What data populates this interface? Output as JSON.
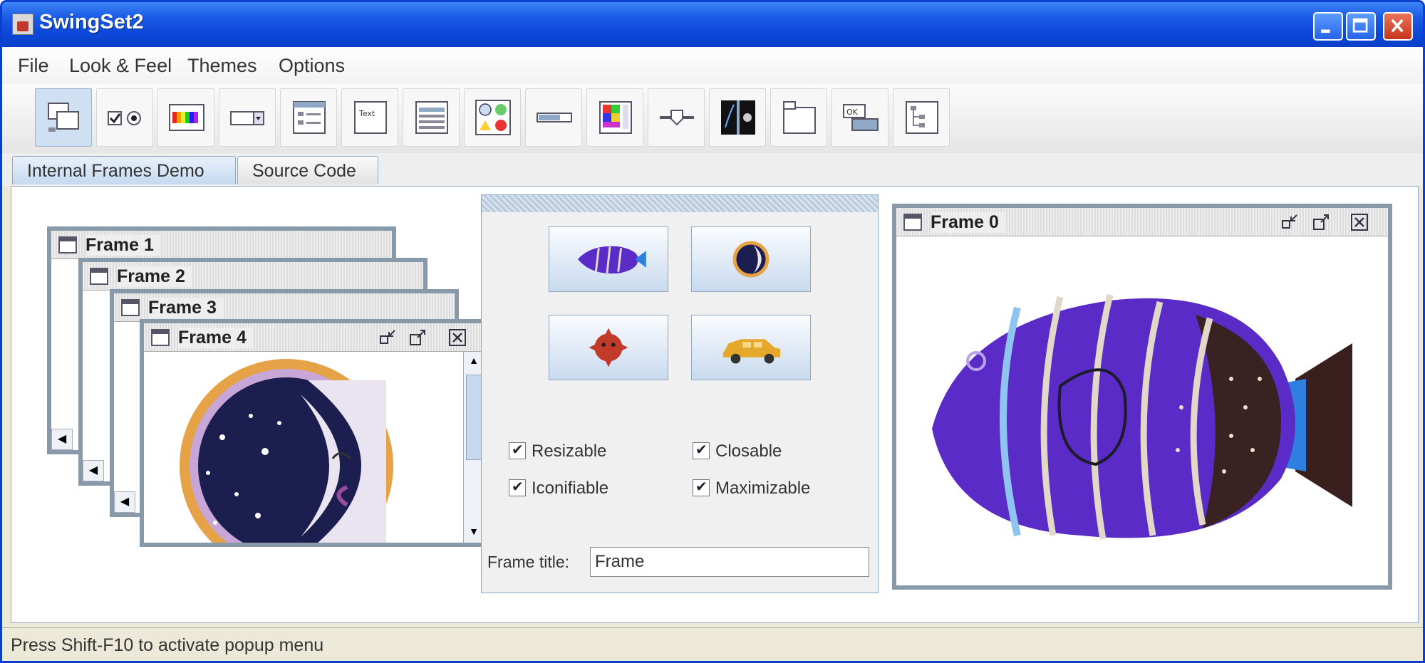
{
  "window": {
    "title": "SwingSet2"
  },
  "menu": {
    "items": [
      "File",
      "Look & Feel",
      "Themes",
      "Options"
    ]
  },
  "toolbar": {
    "tools": [
      "internal-frames-demo-icon",
      "checkbox-radio-demo-icon",
      "color-chooser-demo-icon",
      "combobox-demo-icon",
      "file-chooser-demo-icon",
      "html-demo-icon",
      "list-demo-icon",
      "option-pane-demo-icon",
      "progress-bar-demo-icon",
      "scroll-pane-demo-icon",
      "slider-demo-icon",
      "split-pane-demo-icon",
      "tabbed-pane-demo-icon",
      "table-demo-icon",
      "tree-demo-icon"
    ]
  },
  "tabs": [
    {
      "label": "Internal Frames Demo",
      "selected": true
    },
    {
      "label": "Source Code",
      "selected": false
    }
  ],
  "frames": {
    "frame1": "Frame 1",
    "frame2": "Frame 2",
    "frame3": "Frame 3",
    "frame4": "Frame 4",
    "frame0": "Frame 0"
  },
  "controls": {
    "checkboxes": [
      {
        "label": "Resizable",
        "checked": true
      },
      {
        "label": "Closable",
        "checked": true
      },
      {
        "label": "Iconifiable",
        "checked": true
      },
      {
        "label": "Maximizable",
        "checked": true
      }
    ],
    "frame_title_label": "Frame title:",
    "frame_title_value": "Frame"
  },
  "status": {
    "text": "Press Shift-F10 to activate popup menu"
  },
  "colors": {
    "titlebar": "#0a47d8",
    "frame_border": "#8899aa",
    "accent": "#8fa8c6",
    "fish_purple": "#5a2bc7"
  }
}
